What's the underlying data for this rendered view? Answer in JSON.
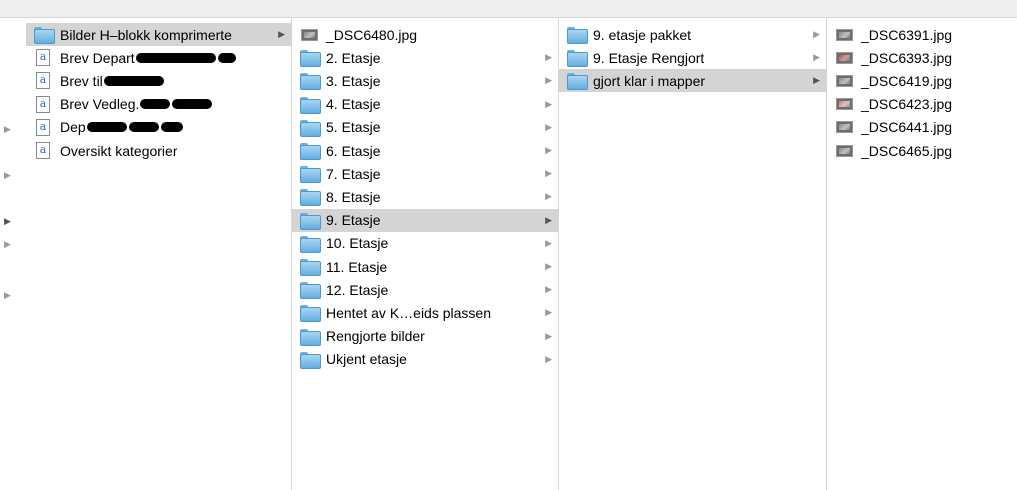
{
  "column1": [
    {
      "type": "folder",
      "label": "Bilder H–blokk komprimerte",
      "selected": true,
      "has_children": true
    },
    {
      "type": "doc",
      "label": "Brev Depart",
      "redacted_suffix": true
    },
    {
      "type": "doc",
      "label": "Brev til",
      "redacted_suffix": true
    },
    {
      "type": "doc",
      "label": "Brev Vedleg.",
      "redacted_suffix": true
    },
    {
      "type": "doc",
      "label": "Dep",
      "redacted_suffix": true
    },
    {
      "type": "doc",
      "label": "Oversikt kategorier"
    }
  ],
  "column2": [
    {
      "type": "image",
      "label": "_DSC6480.jpg"
    },
    {
      "type": "folder",
      "label": "2. Etasje",
      "has_children": true
    },
    {
      "type": "folder",
      "label": "3. Etasje",
      "has_children": true
    },
    {
      "type": "folder",
      "label": "4. Etasje",
      "has_children": true
    },
    {
      "type": "folder",
      "label": "5. Etasje",
      "has_children": true
    },
    {
      "type": "folder",
      "label": "6. Etasje",
      "has_children": true
    },
    {
      "type": "folder",
      "label": "7. Etasje",
      "has_children": true
    },
    {
      "type": "folder",
      "label": "8. Etasje",
      "has_children": true
    },
    {
      "type": "folder",
      "label": "9. Etasje",
      "has_children": true,
      "selected": true
    },
    {
      "type": "folder",
      "label": "10. Etasje",
      "has_children": true
    },
    {
      "type": "folder",
      "label": "11. Etasje",
      "has_children": true
    },
    {
      "type": "folder",
      "label": "12. Etasje",
      "has_children": true
    },
    {
      "type": "folder",
      "label": "Hentet av K…eids plassen",
      "has_children": true
    },
    {
      "type": "folder",
      "label": "Rengjorte bilder",
      "has_children": true
    },
    {
      "type": "folder",
      "label": "Ukjent etasje",
      "has_children": true
    }
  ],
  "column3": [
    {
      "type": "folder",
      "label": "9. etasje pakket",
      "has_children": true
    },
    {
      "type": "folder",
      "label": "9. Etasje Rengjort",
      "has_children": true
    },
    {
      "type": "folder",
      "label": "gjort klar i mapper",
      "has_children": true,
      "selected": true
    }
  ],
  "column4": [
    {
      "type": "image",
      "label": "_DSC6391.jpg",
      "tint": "gray"
    },
    {
      "type": "image",
      "label": "_DSC6393.jpg",
      "tint": "red"
    },
    {
      "type": "image",
      "label": "_DSC6419.jpg",
      "tint": "gray"
    },
    {
      "type": "image",
      "label": "_DSC6423.jpg",
      "tint": "pink"
    },
    {
      "type": "image",
      "label": "_DSC6441.jpg",
      "tint": "gray"
    },
    {
      "type": "image",
      "label": "_DSC6465.jpg",
      "tint": "gray"
    }
  ],
  "icons": {
    "folder": "folder-icon",
    "doc": "text-document-icon",
    "image": "jpeg-image-icon",
    "disclosure": "disclosure-triangle-icon"
  },
  "colors": {
    "selection": "#d4d4d4",
    "folder_blue": "#63aee0",
    "separator": "#d6d6d6"
  }
}
